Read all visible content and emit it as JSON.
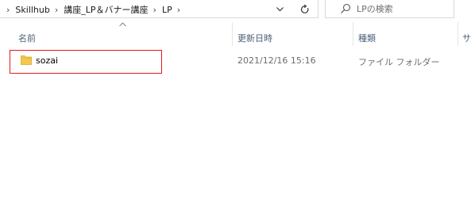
{
  "breadcrumb": {
    "items": [
      "Skillhub",
      "講座_LP＆バナー講座",
      "LP"
    ]
  },
  "search": {
    "placeholder": "LPの検索"
  },
  "columns": {
    "name": "名前",
    "date": "更新日時",
    "type": "種類",
    "size": "サ"
  },
  "rows": [
    {
      "name": "sozai",
      "date": "2021/12/16 15:16",
      "type": "ファイル フォルダー"
    }
  ],
  "icons": {
    "separator": "chevron-right-icon",
    "dropdown": "chevron-down-icon",
    "refresh": "refresh-icon",
    "search": "search-icon",
    "folder": "folder-icon",
    "sort": "sort-up-icon"
  },
  "colors": {
    "header_text": "#4c607a",
    "meta_text": "#6d6d6d",
    "highlight_border": "#e11b22",
    "folder": "#f2c94c"
  }
}
